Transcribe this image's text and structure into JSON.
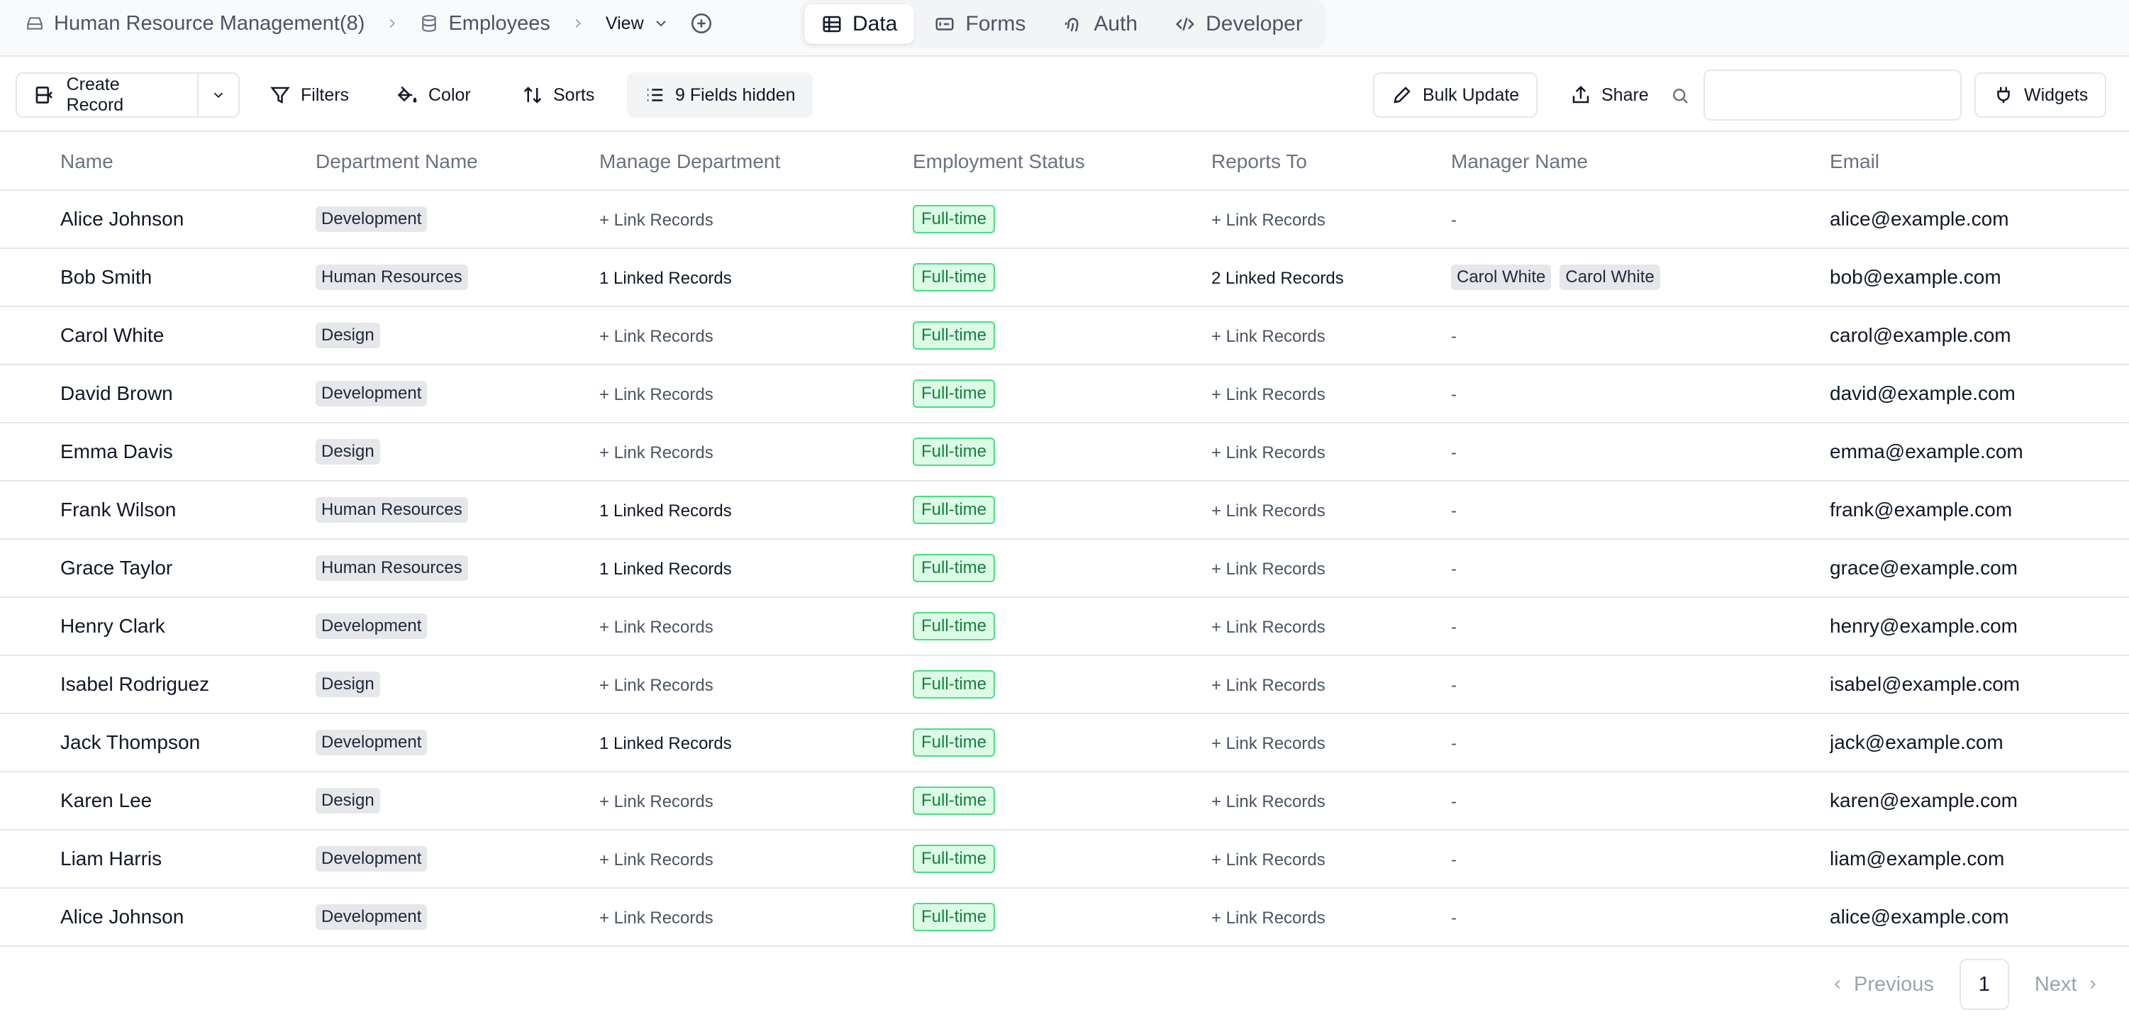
{
  "breadcrumb": {
    "base_label": "Human Resource Management(8)",
    "table_label": "Employees",
    "view_label": "View"
  },
  "tabs": [
    {
      "label": "Data",
      "icon": "table-icon",
      "active": true
    },
    {
      "label": "Forms",
      "icon": "form-icon",
      "active": false
    },
    {
      "label": "Auth",
      "icon": "fingerprint-icon",
      "active": false
    },
    {
      "label": "Developer",
      "icon": "code-icon",
      "active": false
    }
  ],
  "toolbar": {
    "create_label": "Create Record",
    "filters_label": "Filters",
    "color_label": "Color",
    "sorts_label": "Sorts",
    "hidden_label": "9 Fields hidden",
    "bulk_label": "Bulk Update",
    "share_label": "Share",
    "search_value": "",
    "widgets_label": "Widgets"
  },
  "columns": [
    "Name",
    "Department Name",
    "Manage Department",
    "Employment Status",
    "Reports To",
    "Manager Name",
    "Email"
  ],
  "rows": [
    {
      "name": "Alice Johnson",
      "dept": "Development",
      "manage": "+ Link Records",
      "status": "Full-time",
      "reports": "+ Link Records",
      "managers": [],
      "email": "alice@example.com"
    },
    {
      "name": "Bob Smith",
      "dept": "Human Resources",
      "manage": "1 Linked Records",
      "status": "Full-time",
      "reports": "2 Linked Records",
      "managers": [
        "Carol White",
        "Carol White"
      ],
      "email": "bob@example.com"
    },
    {
      "name": "Carol White",
      "dept": "Design",
      "manage": "+ Link Records",
      "status": "Full-time",
      "reports": "+ Link Records",
      "managers": [],
      "email": "carol@example.com"
    },
    {
      "name": "David Brown",
      "dept": "Development",
      "manage": "+ Link Records",
      "status": "Full-time",
      "reports": "+ Link Records",
      "managers": [],
      "email": "david@example.com"
    },
    {
      "name": "Emma Davis",
      "dept": "Design",
      "manage": "+ Link Records",
      "status": "Full-time",
      "reports": "+ Link Records",
      "managers": [],
      "email": "emma@example.com"
    },
    {
      "name": "Frank Wilson",
      "dept": "Human Resources",
      "manage": "1 Linked Records",
      "status": "Full-time",
      "reports": "+ Link Records",
      "managers": [],
      "email": "frank@example.com"
    },
    {
      "name": "Grace Taylor",
      "dept": "Human Resources",
      "manage": "1 Linked Records",
      "status": "Full-time",
      "reports": "+ Link Records",
      "managers": [],
      "email": "grace@example.com"
    },
    {
      "name": "Henry Clark",
      "dept": "Development",
      "manage": "+ Link Records",
      "status": "Full-time",
      "reports": "+ Link Records",
      "managers": [],
      "email": "henry@example.com"
    },
    {
      "name": "Isabel Rodriguez",
      "dept": "Design",
      "manage": "+ Link Records",
      "status": "Full-time",
      "reports": "+ Link Records",
      "managers": [],
      "email": "isabel@example.com"
    },
    {
      "name": "Jack Thompson",
      "dept": "Development",
      "manage": "1 Linked Records",
      "status": "Full-time",
      "reports": "+ Link Records",
      "managers": [],
      "email": "jack@example.com"
    },
    {
      "name": "Karen Lee",
      "dept": "Design",
      "manage": "+ Link Records",
      "status": "Full-time",
      "reports": "+ Link Records",
      "managers": [],
      "email": "karen@example.com"
    },
    {
      "name": "Liam Harris",
      "dept": "Development",
      "manage": "+ Link Records",
      "status": "Full-time",
      "reports": "+ Link Records",
      "managers": [],
      "email": "liam@example.com"
    },
    {
      "name": "Alice Johnson",
      "dept": "Development",
      "manage": "+ Link Records",
      "status": "Full-time",
      "reports": "+ Link Records",
      "managers": [],
      "email": "alice@example.com"
    }
  ],
  "empty_placeholder": "-",
  "pagination": {
    "previous_label": "Previous",
    "current_page": "1",
    "next_label": "Next"
  }
}
